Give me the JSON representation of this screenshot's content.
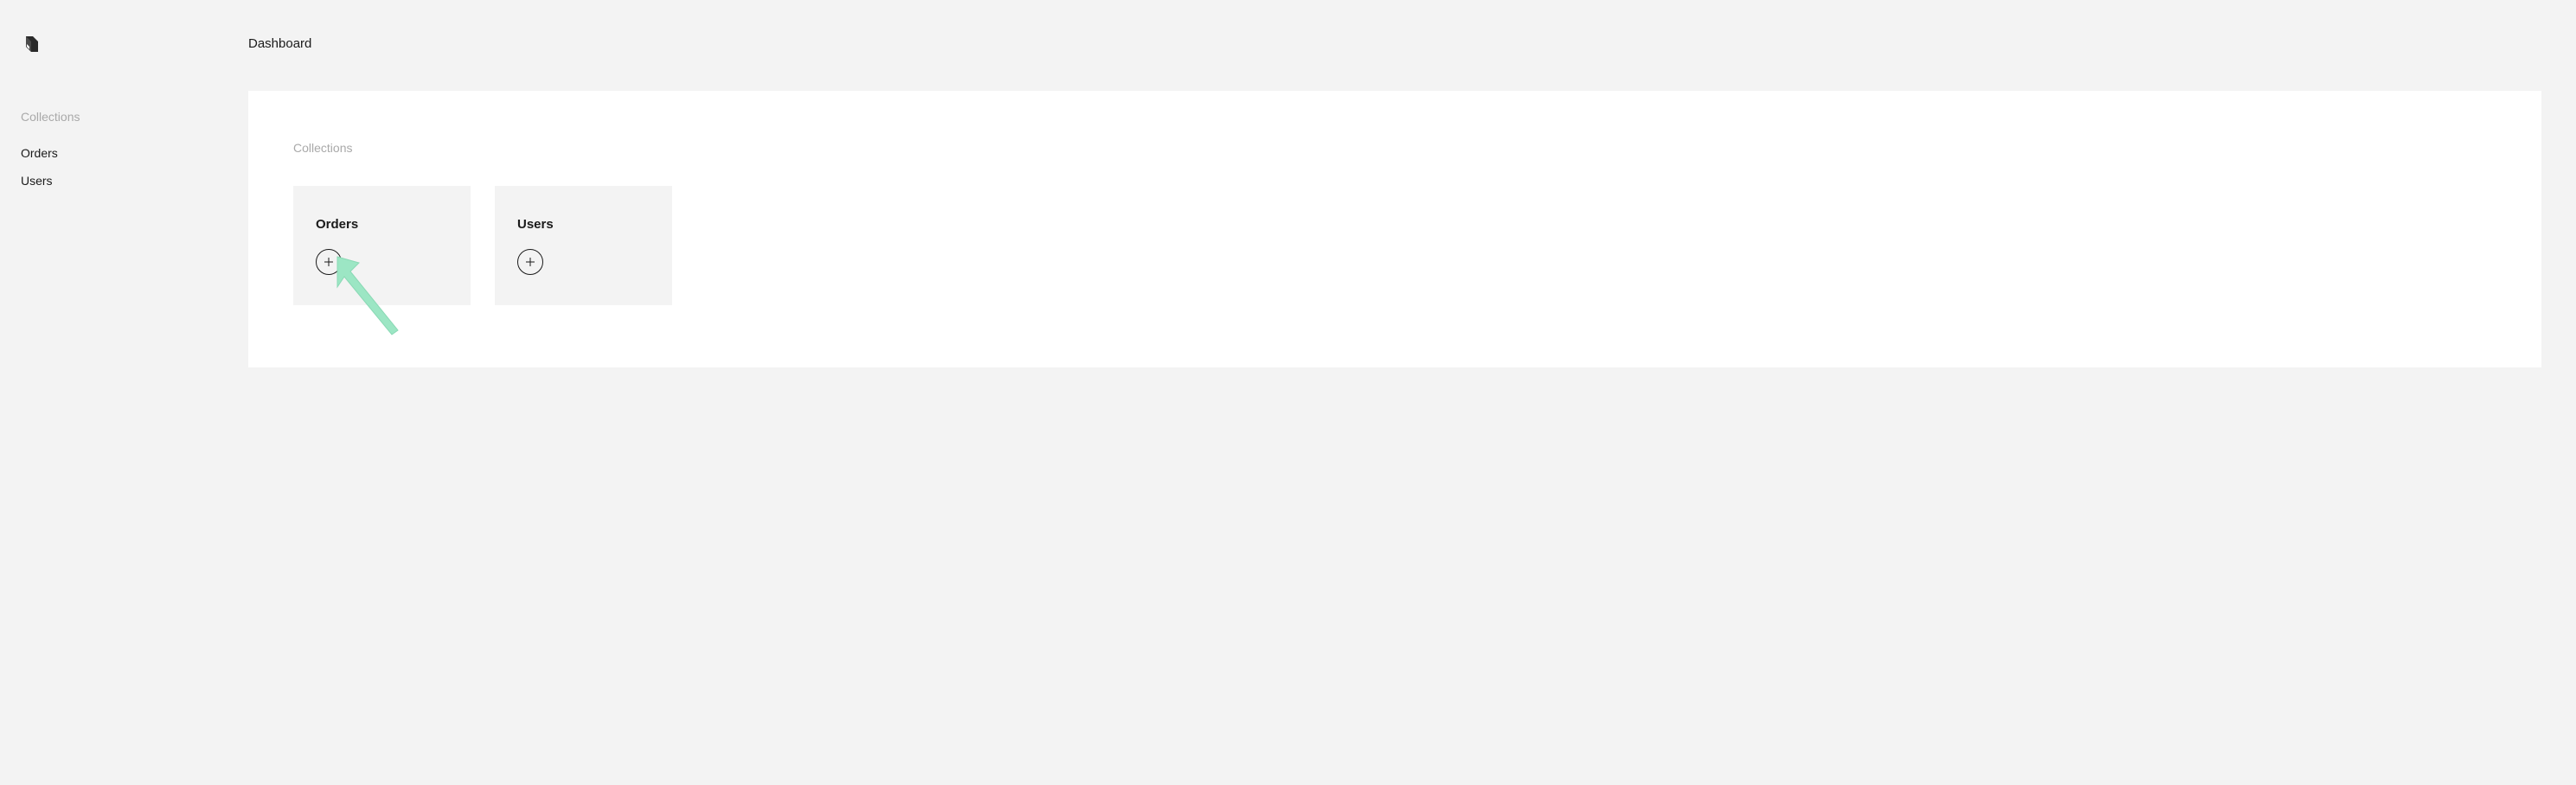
{
  "page": {
    "title": "Dashboard"
  },
  "sidebar": {
    "section_heading": "Collections",
    "items": [
      {
        "label": "Orders"
      },
      {
        "label": "Users"
      }
    ]
  },
  "content": {
    "section_heading": "Collections",
    "cards": [
      {
        "title": "Orders"
      },
      {
        "title": "Users"
      }
    ]
  }
}
